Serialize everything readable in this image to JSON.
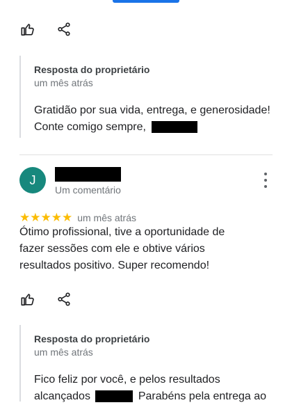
{
  "review_1": {
    "owner_reply": {
      "title": "Resposta do proprietário",
      "date": "um mês atrás",
      "text_before": "Gratidão por sua vida, entrega, e generosidade! Conte comigo sempre,"
    }
  },
  "review_2": {
    "avatar_initial": "J",
    "review_count": "Um comentário",
    "stars": "★★★★★",
    "rating": 5,
    "date": "um mês atrás",
    "text": "Ótimo profissional, tive a oportunidade de fazer sessões com ele e obtive vários resultados positivo. Super recomendo!",
    "owner_reply": {
      "title": "Resposta do proprietário",
      "date": "um mês atrás",
      "text_before": "Fico feliz por você, e pelos resultados alcançados",
      "text_after": "Parabéns pela entrega ao"
    }
  },
  "icons": {
    "like": "thumb-up-icon",
    "share": "share-icon",
    "more": "more-vertical-icon"
  },
  "colors": {
    "accent": "#1a73e8",
    "avatar": "#17887d",
    "star": "#fbbc04"
  }
}
